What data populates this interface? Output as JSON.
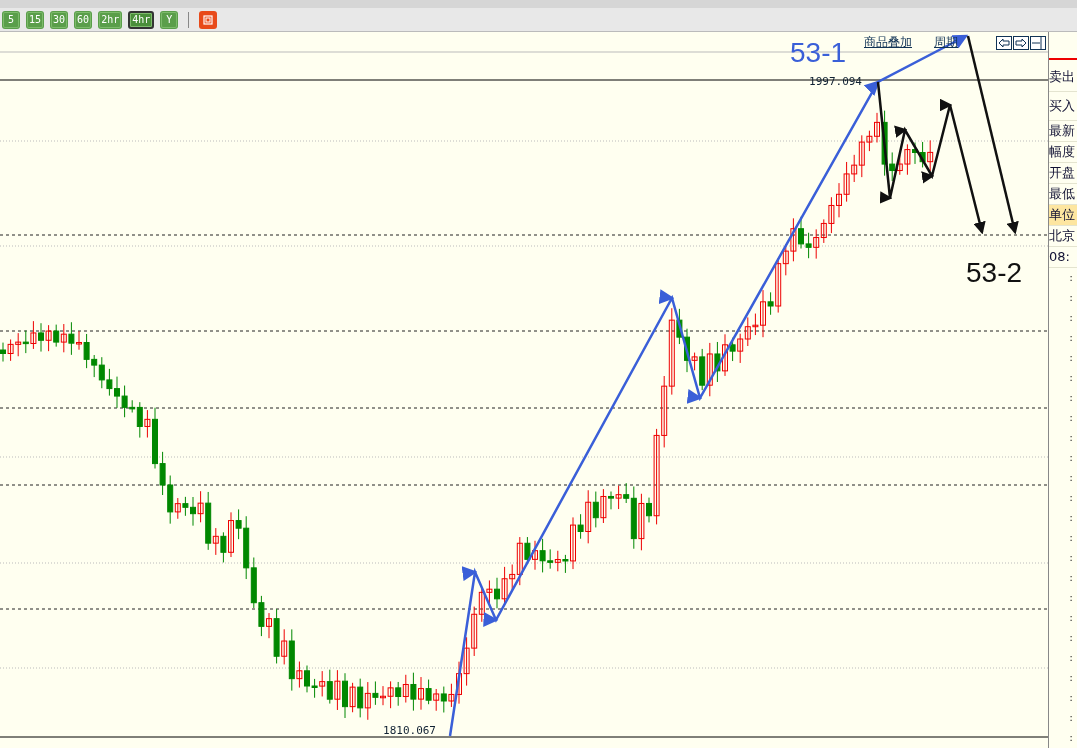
{
  "toolbar": {
    "periods": [
      {
        "label": "5",
        "selected": false
      },
      {
        "label": "15",
        "selected": false
      },
      {
        "label": "30",
        "selected": false
      },
      {
        "label": "60",
        "selected": false
      },
      {
        "label": "2hr",
        "selected": false
      },
      {
        "label": "4hr",
        "selected": true
      },
      {
        "label": "Y",
        "selected": false
      }
    ]
  },
  "chart_header": {
    "links": [
      "商品叠加",
      "周期"
    ]
  },
  "chart": {
    "price_labels": [
      {
        "text": "1997.094",
        "kind": "high"
      },
      {
        "text": "1810.067",
        "kind": "low"
      }
    ],
    "annotations": [
      {
        "text": "53-1",
        "kind": "blue"
      },
      {
        "text": "53-2",
        "kind": "black"
      }
    ]
  },
  "quote_panel": {
    "rows": [
      {
        "label": "卖出",
        "highlighted": false
      },
      {
        "label": "买入",
        "highlighted": false
      },
      {
        "label": "最新",
        "highlighted": false
      },
      {
        "label": "幅度",
        "highlighted": false
      },
      {
        "label": "开盘",
        "highlighted": false
      },
      {
        "label": "最低",
        "highlighted": false
      },
      {
        "label": "单位",
        "highlighted": true
      },
      {
        "label": "北京",
        "highlighted": false
      },
      {
        "label": "08:",
        "highlighted": false
      }
    ],
    "time_rows": [
      ":",
      ":",
      ":",
      ":",
      ":",
      ":",
      ":",
      ":",
      ":",
      ":",
      ":",
      ":",
      ":",
      ":",
      ":",
      ":",
      ":",
      ":",
      ":",
      ":",
      ":",
      ":",
      ":",
      ":"
    ]
  }
}
